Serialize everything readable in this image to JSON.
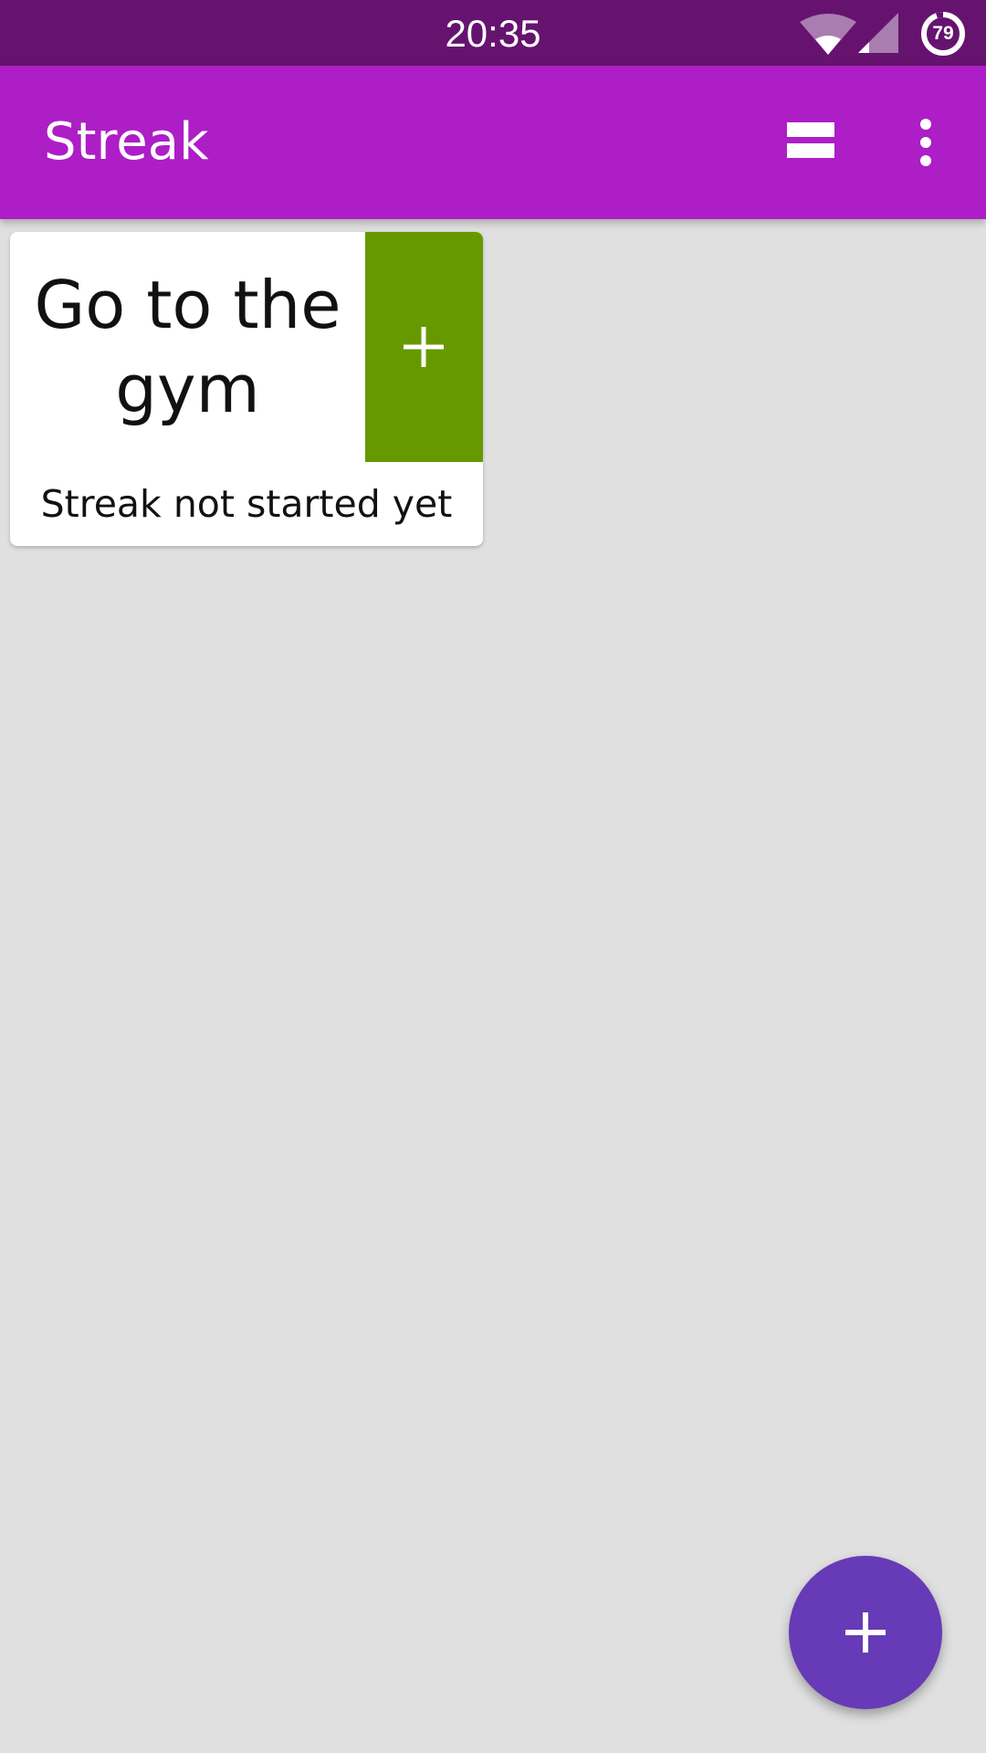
{
  "status_bar": {
    "time": "20:35",
    "battery_level": "79",
    "icons": [
      "wifi-icon",
      "cellular-signal-icon",
      "battery-icon"
    ]
  },
  "app_bar": {
    "title": "Streak",
    "actions": [
      "layout-toggle-icon",
      "more-vert-icon"
    ]
  },
  "streaks": [
    {
      "title": "Go to the gym",
      "status": "Streak not started yet",
      "increment_icon": "plus-icon"
    }
  ],
  "fab": {
    "icon": "plus-icon"
  },
  "colors": {
    "status_bar": "#65136F",
    "app_bar": "#AD1EC6",
    "background": "#E0E0E0",
    "card_action": "#669900",
    "fab": "#673AB7"
  }
}
